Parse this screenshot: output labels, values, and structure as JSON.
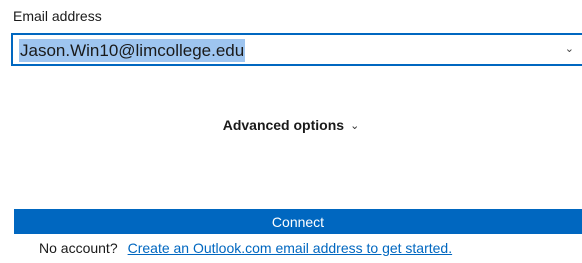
{
  "email": {
    "label": "Email address",
    "value": "Jason.Win10@limcollege.edu",
    "dropdown_icon": "chevron-down-icon"
  },
  "advanced": {
    "label": "Advanced options",
    "icon": "chevron-down-icon"
  },
  "connect": {
    "label": "Connect"
  },
  "footer": {
    "prompt": "No account?",
    "link": "Create an Outlook.com email address to get started."
  },
  "colors": {
    "accent": "#0067c0",
    "selection": "#9ec5f0"
  }
}
